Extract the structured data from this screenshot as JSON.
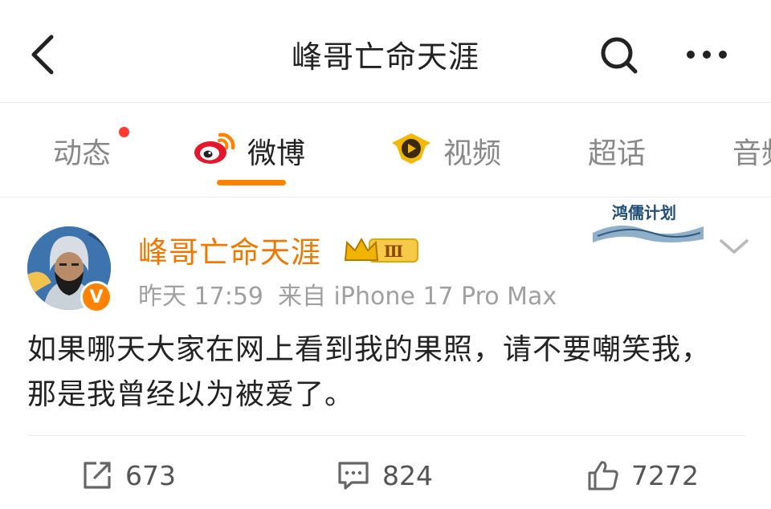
{
  "header": {
    "title": "峰哥亡命天涯",
    "back_icon": "chevron-left-icon",
    "search_icon": "search-icon",
    "more_icon": "more-dots-icon"
  },
  "tabs": [
    {
      "label": "动态",
      "active": false,
      "has_dot": true
    },
    {
      "label": "微博",
      "active": true,
      "icon": "weibo-logo-icon"
    },
    {
      "label": "视频",
      "active": false,
      "icon": "video-badge-icon"
    },
    {
      "label": "超话",
      "active": false
    },
    {
      "label": "音频",
      "active": false
    }
  ],
  "post": {
    "author": "峰哥亡命天涯",
    "level": "Ⅲ",
    "verified": "V",
    "time": "昨天 17:59",
    "source": "来自 iPhone 17 Pro Max",
    "campaign": "鸿儒计划",
    "content": "如果哪天大家在网上看到我的果照，请不要嘲笑我，那是我曾经以为被爱了。"
  },
  "actions": {
    "repost": "673",
    "comment": "824",
    "like": "7272"
  },
  "colors": {
    "accent": "#ff8200",
    "author": "#f07800",
    "meta": "#a0a0a0"
  }
}
